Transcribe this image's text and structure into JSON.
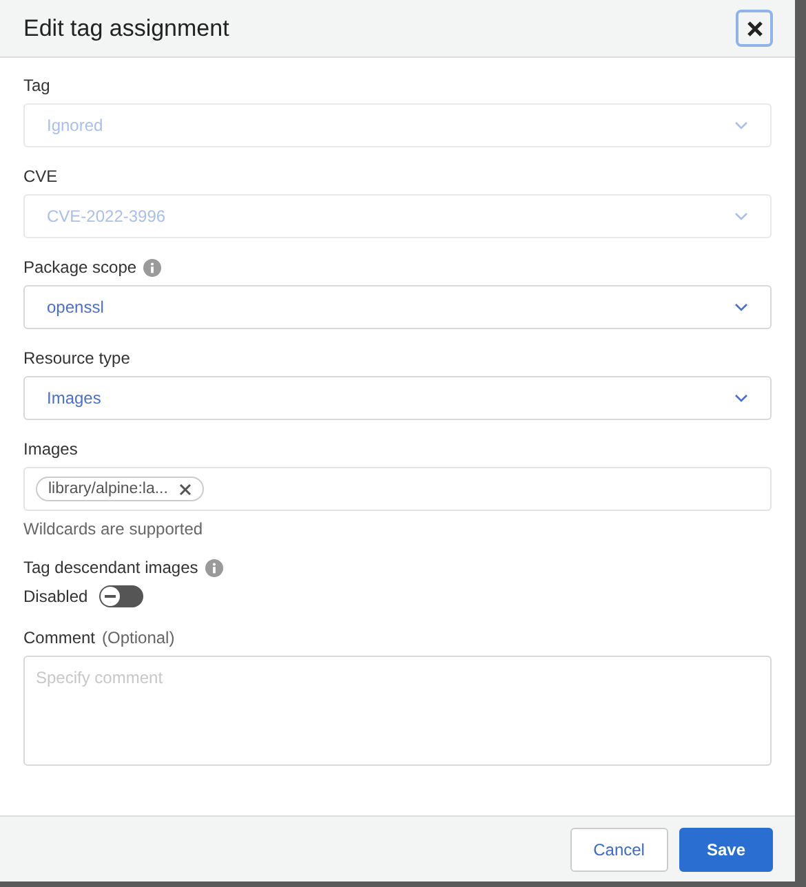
{
  "dialog": {
    "title": "Edit tag assignment"
  },
  "fields": [
    {
      "kind": "select",
      "label": "Tag",
      "info": false,
      "value": "Ignored",
      "disabled": true
    },
    {
      "kind": "select",
      "label": "CVE",
      "info": false,
      "value": "CVE-2022-3996",
      "disabled": true
    },
    {
      "kind": "select",
      "label": "Package scope",
      "info": true,
      "value": "openssl",
      "disabled": false
    },
    {
      "kind": "select",
      "label": "Resource type",
      "info": false,
      "value": "Images",
      "disabled": false
    },
    {
      "kind": "chips",
      "label": "Images",
      "info": false,
      "chips": [
        "library/alpine:la..."
      ],
      "hint": "Wildcards are supported"
    },
    {
      "kind": "toggle",
      "label": "Tag descendant images",
      "info": true,
      "state_label": "Disabled",
      "on": false
    },
    {
      "kind": "textarea",
      "label": "Comment",
      "optional": "(Optional)",
      "info": false,
      "placeholder": "Specify comment"
    }
  ],
  "buttons": [
    {
      "label": "Cancel",
      "primary": false
    },
    {
      "label": "Save",
      "primary": true
    }
  ]
}
